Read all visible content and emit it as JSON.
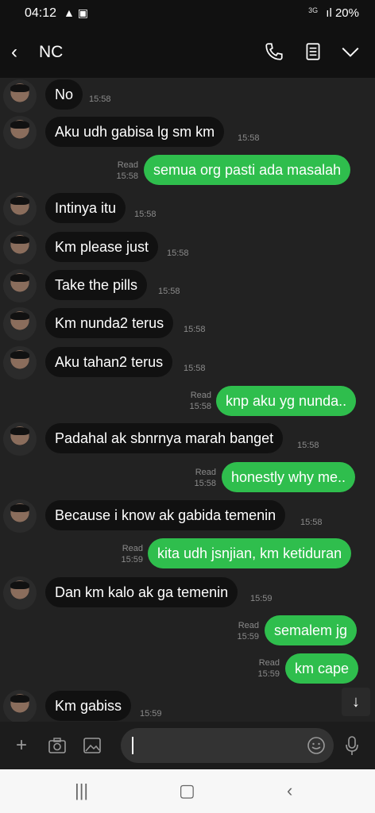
{
  "status": {
    "time": "04:12",
    "net": "3G",
    "battery": "20%"
  },
  "header": {
    "title": "NC"
  },
  "messages": [
    {
      "dir": "in",
      "text": "No",
      "time": "15:58"
    },
    {
      "dir": "in",
      "text": "Aku udh gabisa lg sm km",
      "time": "15:58"
    },
    {
      "dir": "out",
      "text": "semua org pasti ada masalah",
      "read": "Read",
      "time": "15:58"
    },
    {
      "dir": "in",
      "text": "Intinya itu",
      "time": "15:58"
    },
    {
      "dir": "in",
      "text": "Km please just",
      "time": "15:58"
    },
    {
      "dir": "in",
      "text": "Take the pills",
      "time": "15:58"
    },
    {
      "dir": "in",
      "text": "Km nunda2 terus",
      "time": "15:58"
    },
    {
      "dir": "in",
      "text": "Aku tahan2 terus",
      "time": "15:58"
    },
    {
      "dir": "out",
      "text": "knp aku yg nunda..",
      "read": "Read",
      "time": "15:58"
    },
    {
      "dir": "in",
      "text": "Padahal ak sbnrnya marah banget",
      "time": "15:58"
    },
    {
      "dir": "out",
      "text": "honestly why me..",
      "read": "Read",
      "time": "15:58"
    },
    {
      "dir": "in",
      "text": "Because i know ak gabida temenin",
      "time": "15:58"
    },
    {
      "dir": "out",
      "text": "kita udh jsnjian, km ketiduran",
      "read": "Read",
      "time": "15:59"
    },
    {
      "dir": "in",
      "text": "Dan km kalo ak ga temenin",
      "time": "15:59"
    },
    {
      "dir": "out",
      "text": "semalem jg",
      "read": "Read",
      "time": "15:59"
    },
    {
      "dir": "out",
      "text": "km cape",
      "read": "Read",
      "time": "15:59"
    },
    {
      "dir": "in",
      "text": "Km gabiss",
      "time": "15:59"
    }
  ],
  "icons": {
    "back": "chevron-left-icon",
    "call": "phone-icon",
    "notes": "notes-icon",
    "menu": "chevron-down-icon",
    "add": "plus-icon",
    "camera": "camera-icon",
    "gallery": "image-icon",
    "emoji": "emoji-icon",
    "mic": "microphone-icon",
    "scroll": "arrow-down-icon"
  },
  "colors": {
    "outgoing": "#2fbe4d",
    "incoming": "#111111",
    "background": "#222222"
  }
}
